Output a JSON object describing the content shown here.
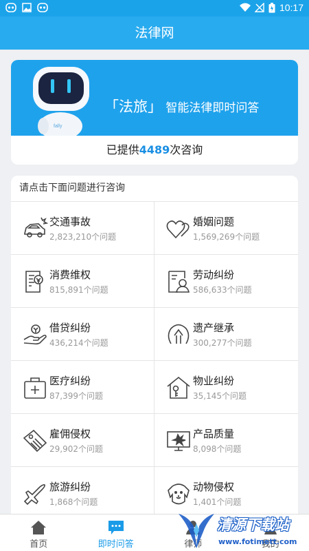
{
  "status_bar": {
    "time": "10:17"
  },
  "app_bar": {
    "title": "法律网"
  },
  "banner": {
    "bracket_open": "「",
    "brand": "法旅",
    "bracket_close": "」",
    "slogan": "智能法律即时问答",
    "robot_badge": "fally"
  },
  "stat": {
    "prefix": "已提供",
    "count": "4489",
    "suffix": "次咨询"
  },
  "qa": {
    "header": "请点击下面问题进行咨询",
    "categories": [
      {
        "title": "交通事故",
        "count": "2,823,210个问题",
        "icon": "car-accident-icon"
      },
      {
        "title": "婚姻问题",
        "count": "1,569,269个问题",
        "icon": "hearts-icon"
      },
      {
        "title": "消费维权",
        "count": "815,891个问题",
        "icon": "receipt-icon"
      },
      {
        "title": "劳动纠纷",
        "count": "586,633个问题",
        "icon": "worker-card-icon"
      },
      {
        "title": "借贷纠纷",
        "count": "436,214个问题",
        "icon": "loan-hand-icon"
      },
      {
        "title": "遗产继承",
        "count": "300,277个问题",
        "icon": "inheritance-icon"
      },
      {
        "title": "医疗纠纷",
        "count": "87,399个问题",
        "icon": "medical-kit-icon"
      },
      {
        "title": "物业纠纷",
        "count": "35,145个问题",
        "icon": "house-key-icon"
      },
      {
        "title": "雇佣侵权",
        "count": "29,902个问题",
        "icon": "badge-icon"
      },
      {
        "title": "产品质量",
        "count": "8,098个问题",
        "icon": "monitor-broken-icon"
      },
      {
        "title": "旅游纠纷",
        "count": "1,868个问题",
        "icon": "airplane-icon"
      },
      {
        "title": "动物侵权",
        "count": "1,401个问题",
        "icon": "dog-icon"
      }
    ]
  },
  "tabbar": {
    "items": [
      {
        "label": "首页",
        "icon": "home-icon",
        "active": false
      },
      {
        "label": "即时问答",
        "icon": "chat-icon",
        "active": true
      },
      {
        "label": "律师",
        "icon": "lawyer-icon",
        "active": false
      },
      {
        "label": "我的",
        "icon": "profile-icon",
        "active": false
      }
    ]
  },
  "watermark": {
    "text": "清源下载站",
    "url": "www.fotimett.com"
  },
  "colors": {
    "primary": "#29abef",
    "accent": "#1a8fe3"
  }
}
